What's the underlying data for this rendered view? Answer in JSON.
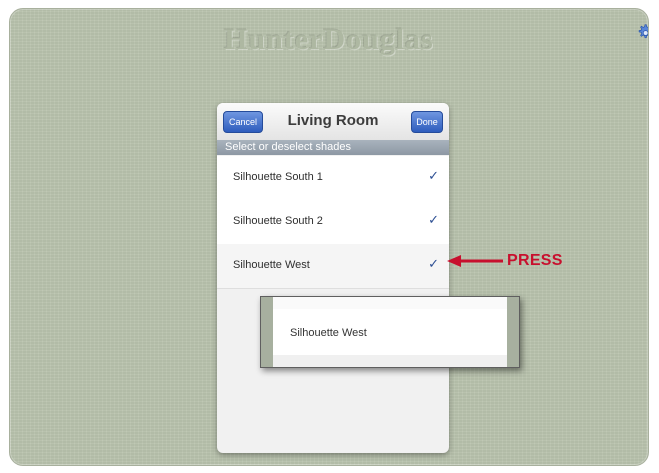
{
  "app": {
    "logo_text": "HunterDouglas"
  },
  "dialog": {
    "title": "Living Room",
    "cancel_label": "Cancel",
    "done_label": "Done",
    "section_label": "Select or deselect shades",
    "rows": [
      {
        "label": "Silhouette South 1",
        "check": "✓"
      },
      {
        "label": "Silhouette South 2",
        "check": "✓"
      },
      {
        "label": "Silhouette West",
        "check": "✓"
      }
    ]
  },
  "callout": {
    "press_label": "PRESS",
    "zoom_label": "Silhouette West"
  },
  "colors": {
    "background": "#b9c3ad",
    "accent_button": "#2e5dbd",
    "press_red": "#c8102e",
    "check_blue": "#2d4f93"
  },
  "icons": {
    "settings": "gear-icon",
    "checkmark": "checkmark-icon",
    "arrow": "arrow-left-icon"
  }
}
